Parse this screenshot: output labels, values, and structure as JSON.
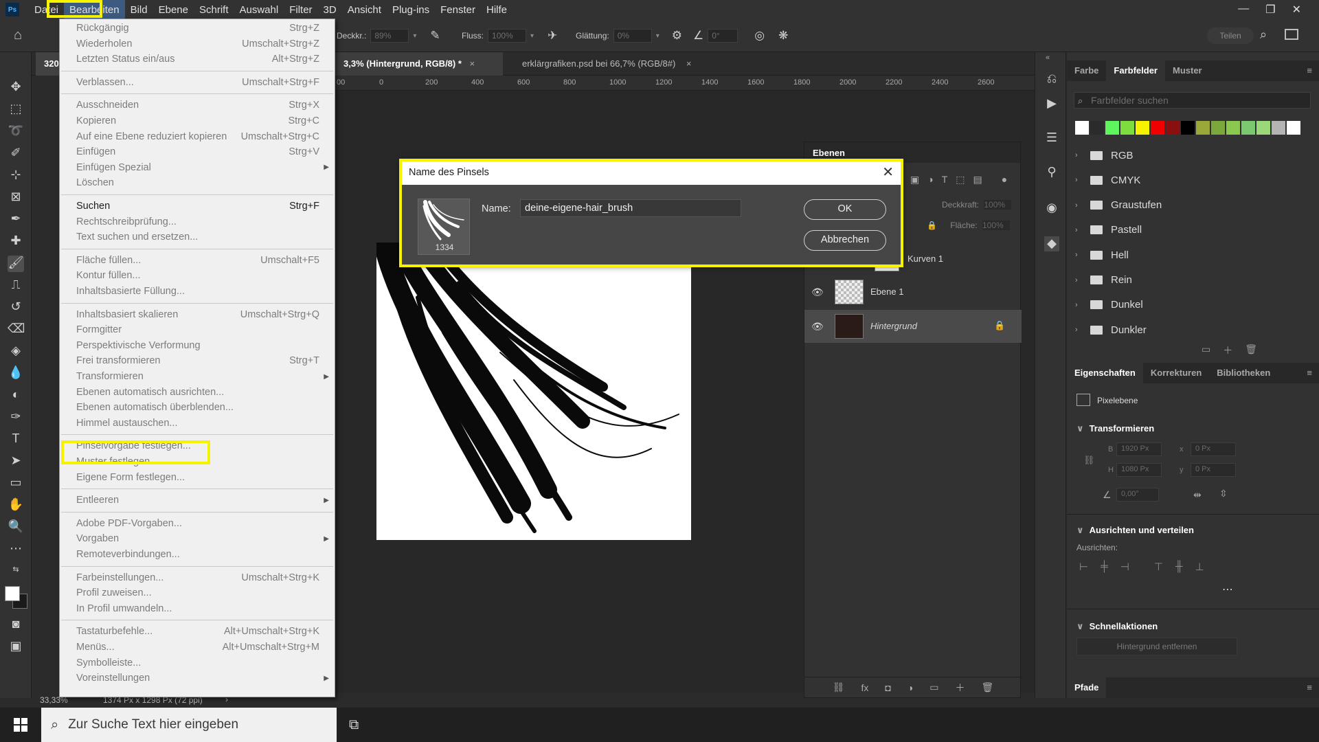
{
  "menubar": {
    "logo": "Ps",
    "items": [
      "Datei",
      "Bearbeiten",
      "Bild",
      "Ebene",
      "Schrift",
      "Auswahl",
      "Filter",
      "3D",
      "Ansicht",
      "Plug-ins",
      "Fenster",
      "Hilfe"
    ],
    "active_index": 1,
    "win_controls": [
      "—",
      "❐",
      "✕"
    ]
  },
  "options": {
    "opacity_label": "Deckkr.:",
    "opacity_value": "89%",
    "flow_label": "Fluss:",
    "flow_value": "100%",
    "smoothing_label": "Glättung:",
    "smoothing_value": "0%",
    "angle_value": "0°",
    "share_label": "Teilen"
  },
  "tabs": {
    "first_tab": "320",
    "active_tab": "3,3% (Hintergrund, RGB/8) *",
    "second_tab": "erklärgrafiken.psd bei 66,7% (RGB/8#)",
    "close": "×"
  },
  "ruler": [
    "00",
    "0",
    "200",
    "400",
    "600",
    "800",
    "1000",
    "1200",
    "1400",
    "1600",
    "1800",
    "2000",
    "2200",
    "2400",
    "2600"
  ],
  "status": {
    "zoom": "33,33%",
    "doc_info": "1374 Px x 1298 Px (72 ppi)",
    "arrow": "›"
  },
  "edit_menu": {
    "items": [
      {
        "label": "Rückgängig",
        "shortcut": "Strg+Z",
        "disabled": true
      },
      {
        "label": "Wiederholen",
        "shortcut": "Umschalt+Strg+Z",
        "disabled": true
      },
      {
        "label": "Letzten Status ein/aus",
        "shortcut": "Alt+Strg+Z",
        "disabled": true
      },
      {
        "label": "Verblassen...",
        "shortcut": "Umschalt+Strg+F",
        "disabled": true
      },
      {
        "label": "Ausschneiden",
        "shortcut": "Strg+X",
        "disabled": true
      },
      {
        "label": "Kopieren",
        "shortcut": "Strg+C",
        "disabled": true
      },
      {
        "label": "Auf eine Ebene reduziert kopieren",
        "shortcut": "Umschalt+Strg+C",
        "disabled": true
      },
      {
        "label": "Einfügen",
        "shortcut": "Strg+V",
        "disabled": true
      },
      {
        "label": "Einfügen Spezial",
        "shortcut": "",
        "disabled": true,
        "submenu": true
      },
      {
        "label": "Löschen",
        "shortcut": "",
        "disabled": true
      },
      {
        "label": "Suchen",
        "shortcut": "Strg+F",
        "disabled": false
      },
      {
        "label": "Rechtschreibprüfung...",
        "shortcut": "",
        "disabled": true
      },
      {
        "label": "Text suchen und ersetzen...",
        "shortcut": "",
        "disabled": true
      },
      {
        "label": "Fläche füllen...",
        "shortcut": "Umschalt+F5",
        "disabled": true
      },
      {
        "label": "Kontur füllen...",
        "shortcut": "",
        "disabled": true
      },
      {
        "label": "Inhaltsbasierte Füllung...",
        "shortcut": "",
        "disabled": true
      },
      {
        "label": "Inhaltsbasiert skalieren",
        "shortcut": "Umschalt+Strg+Q",
        "disabled": true
      },
      {
        "label": "Formgitter",
        "shortcut": "",
        "disabled": true
      },
      {
        "label": "Perspektivische Verformung",
        "shortcut": "",
        "disabled": true
      },
      {
        "label": "Frei transformieren",
        "shortcut": "Strg+T",
        "disabled": true
      },
      {
        "label": "Transformieren",
        "shortcut": "",
        "disabled": true,
        "submenu": true
      },
      {
        "label": "Ebenen automatisch ausrichten...",
        "shortcut": "",
        "disabled": true
      },
      {
        "label": "Ebenen automatisch überblenden...",
        "shortcut": "",
        "disabled": true
      },
      {
        "label": "Himmel austauschen...",
        "shortcut": "",
        "disabled": true
      },
      {
        "label": "Pinselvorgabe festlegen...",
        "shortcut": "",
        "disabled": true
      },
      {
        "label": "Muster festlegen...",
        "shortcut": "",
        "disabled": true
      },
      {
        "label": "Eigene Form festlegen...",
        "shortcut": "",
        "disabled": true
      },
      {
        "label": "Entleeren",
        "shortcut": "",
        "disabled": true,
        "submenu": true
      },
      {
        "label": "Adobe PDF-Vorgaben...",
        "shortcut": "",
        "disabled": true
      },
      {
        "label": "Vorgaben",
        "shortcut": "",
        "disabled": true,
        "submenu": true
      },
      {
        "label": "Remoteverbindungen...",
        "shortcut": "",
        "disabled": true
      },
      {
        "label": "Farbeinstellungen...",
        "shortcut": "Umschalt+Strg+K",
        "disabled": true
      },
      {
        "label": "Profil zuweisen...",
        "shortcut": "",
        "disabled": true
      },
      {
        "label": "In Profil umwandeln...",
        "shortcut": "",
        "disabled": true
      },
      {
        "label": "Tastaturbefehle...",
        "shortcut": "Alt+Umschalt+Strg+K",
        "disabled": true
      },
      {
        "label": "Menüs...",
        "shortcut": "Alt+Umschalt+Strg+M",
        "disabled": true
      },
      {
        "label": "Symbolleiste...",
        "shortcut": "",
        "disabled": true
      },
      {
        "label": "Voreinstellungen",
        "shortcut": "",
        "disabled": true,
        "submenu": true
      }
    ]
  },
  "dialog": {
    "title": "Name des Pinsels",
    "brush_size": "1334",
    "name_label": "Name:",
    "name_value": "deine-eigene-hair_brush",
    "ok_label": "OK",
    "cancel_label": "Abbrechen",
    "close": "✕"
  },
  "layers": {
    "title": "Ebenen",
    "opacity_label": "Deckkraft:",
    "opacity_value": "100%",
    "fill_label": "Fläche:",
    "fill_value": "100%",
    "rows": [
      {
        "name": "Kurven 1"
      },
      {
        "name": "Ebene 1"
      },
      {
        "name": "Hintergrund"
      }
    ],
    "footer_icons": [
      "⛓",
      "fx",
      "◘",
      "◑",
      "▭",
      "＋",
      "🗑"
    ]
  },
  "swatches_panel": {
    "tabs": [
      "Farbe",
      "Farbfelder",
      "Muster"
    ],
    "active_tab": 1,
    "search_placeholder": "Farbfelder suchen",
    "colors": [
      "#ffffff",
      "#2b2b2b",
      "#5ef55e",
      "#7edc3e",
      "#f7f300",
      "#f00000",
      "#8a1010",
      "#000000",
      "#9aa83a",
      "#7aa83a",
      "#8ac850",
      "#7ac870",
      "#9bd87a",
      "#b4b4b4",
      "#ffffff"
    ],
    "folders": [
      "RGB",
      "CMYK",
      "Graustufen",
      "Pastell",
      "Hell",
      "Rein",
      "Dunkel",
      "Dunkler"
    ]
  },
  "properties_panel": {
    "tabs": [
      "Eigenschaften",
      "Korrekturen",
      "Bibliotheken"
    ],
    "active_tab": 0,
    "layer_type": "Pixelebene",
    "transform_title": "Transformieren",
    "w_label": "B",
    "w_value": "1920 Px",
    "x_label": "x",
    "x_value": "0 Px",
    "h_label": "H",
    "h_value": "1080 Px",
    "y_label": "y",
    "y_value": "0 Px",
    "angle_value": "0,00°",
    "align_title": "Ausrichten und verteilen",
    "align_label": "Ausrichten:",
    "quick_title": "Schnellaktionen",
    "quick_button": "Hintergrund entfernen",
    "paths_title": "Pfade"
  },
  "taskbar": {
    "search_placeholder": "Zur Suche Text hier eingeben"
  },
  "colors": {
    "highlight": "#f7f300",
    "menu_active": "#3d5a80"
  }
}
